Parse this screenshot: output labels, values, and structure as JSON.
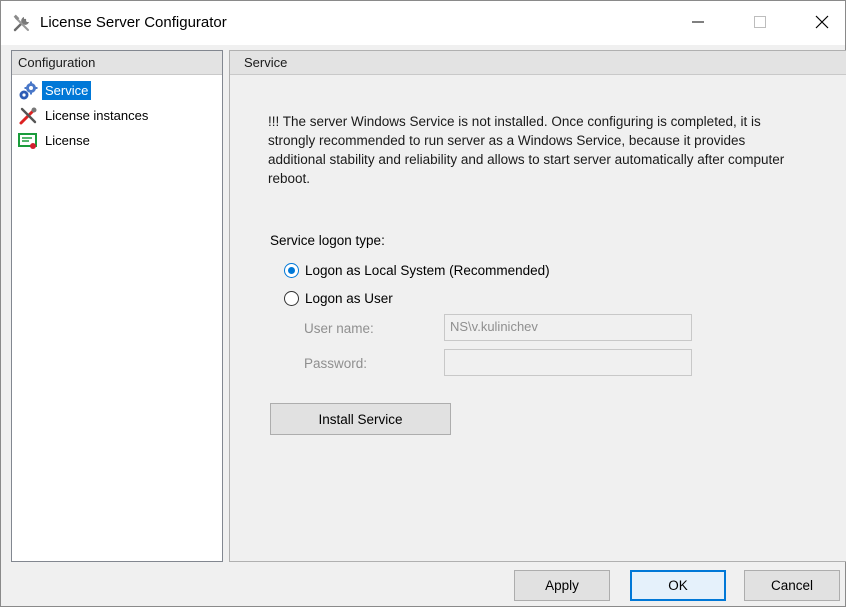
{
  "window": {
    "title": "License Server Configurator",
    "controls": {
      "minimize": "minimize-icon",
      "maximize": "maximize-icon",
      "close": "close-icon"
    }
  },
  "left_panel": {
    "header": "Configuration",
    "items": [
      {
        "label": "Service",
        "icon": "gears-icon",
        "selected": true
      },
      {
        "label": "License instances",
        "icon": "tools-icon",
        "selected": false
      },
      {
        "label": "License",
        "icon": "certificate-icon",
        "selected": false
      }
    ]
  },
  "right_panel": {
    "header": "Service",
    "notice": "!!! The server Windows Service is not installed. Once configuring is completed, it is strongly recommended to run server as a Windows Service, because it provides additional stability and reliability and allows to start server automatically after computer reboot.",
    "logon_type_label": "Service logon type:",
    "logon_options": [
      {
        "label": "Logon as Local System (Recommended)",
        "checked": true
      },
      {
        "label": "Logon as User",
        "checked": false
      }
    ],
    "user_name": {
      "label": "User name:",
      "value": "NS\\v.kulinichev"
    },
    "password": {
      "label": "Password:",
      "value": ""
    },
    "install_button": "Install Service"
  },
  "footer": {
    "apply": "Apply",
    "ok": "OK",
    "cancel": "Cancel"
  },
  "colors": {
    "selection": "#0078d7",
    "window_bg": "#f0f0f0",
    "disabled_text": "#8f8f8f"
  }
}
